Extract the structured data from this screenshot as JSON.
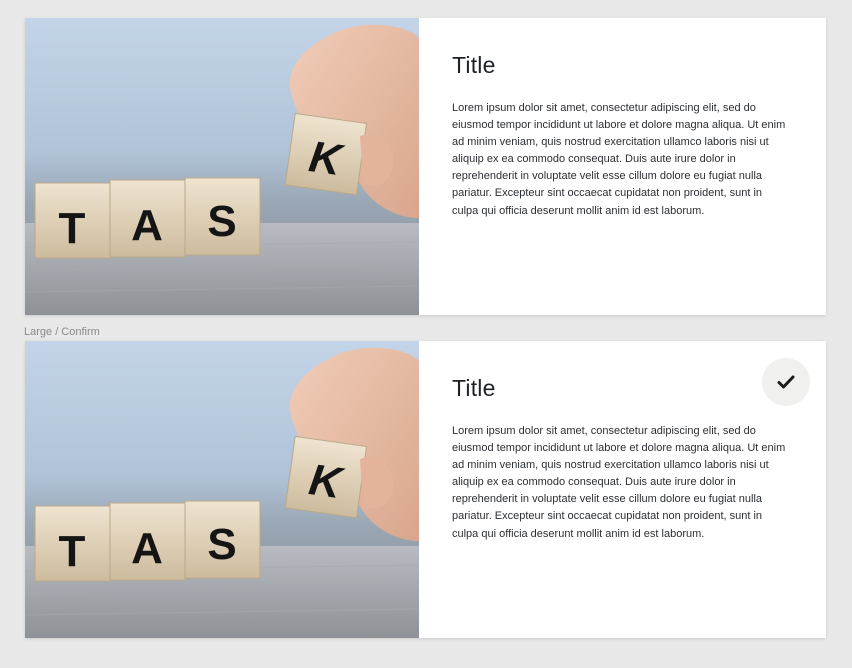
{
  "frame_label": "Large / Confirm",
  "cards": [
    {
      "title": "Title",
      "body": "Lorem ipsum dolor sit amet, consectetur adipiscing elit, sed do eiusmod tempor incididunt ut labore et dolore magna aliqua. Ut enim ad minim veniam, quis nostrud exercitation ullamco laboris nisi ut aliquip ex ea commodo consequat. Duis aute irure dolor in reprehenderit in voluptate velit esse cillum dolore eu fugiat nulla pariatur. Excepteur sint occaecat cupidatat non proident, sunt in culpa qui officia deserunt mollit anim id est laborum.",
      "image": {
        "blocks": [
          "T",
          "A",
          "S"
        ],
        "held_block": "K"
      }
    },
    {
      "title": "Title",
      "body": "Lorem ipsum dolor sit amet, consectetur adipiscing elit, sed do eiusmod tempor incididunt ut labore et dolore magna aliqua. Ut enim ad minim veniam, quis nostrud exercitation ullamco laboris nisi ut aliquip ex ea commodo consequat. Duis aute irure dolor in reprehenderit in voluptate velit esse cillum dolore eu fugiat nulla pariatur. Excepteur sint occaecat cupidatat non proident, sunt in culpa qui officia deserunt mollit anim id est laborum.",
      "image": {
        "blocks": [
          "T",
          "A",
          "S"
        ],
        "held_block": "K"
      },
      "confirm_icon": "checkmark-icon"
    }
  ]
}
